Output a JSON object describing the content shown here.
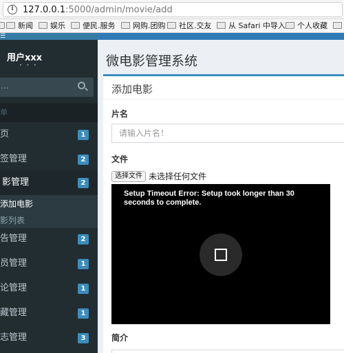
{
  "browser": {
    "url_host": "127.0.0.1",
    "url_rest": ":5000/admin/movie/add",
    "bookmarks": [
      "新闻",
      "娱乐",
      "便民.服务",
      "网购.团购",
      "社区.交友",
      "从 Safari 中导入",
      "个人收藏"
    ]
  },
  "sidebar": {
    "user_name": "用户xxx",
    "user_status": "• • •",
    "search_placeholder": "...",
    "menu_header": "单",
    "items": [
      {
        "label": "页",
        "badge": "1"
      },
      {
        "label": "签管理",
        "badge": "2"
      },
      {
        "label": "影管理",
        "badge": "2"
      },
      {
        "label": "告管理",
        "badge": "2"
      },
      {
        "label": "员管理",
        "badge": "1"
      },
      {
        "label": "论管理",
        "badge": "1"
      },
      {
        "label": "藏管理",
        "badge": "1"
      },
      {
        "label": "志管理",
        "badge": "3"
      }
    ],
    "submenu": {
      "current": "添加电影",
      "other": "影列表"
    }
  },
  "content": {
    "page_title": "微电影管理系统",
    "box_title": "添加电影",
    "field_title_label": "片名",
    "field_title_placeholder": "请输入片名！",
    "field_file_label": "文件",
    "file_button": "选择文件",
    "file_status": "未选择任何文件",
    "player_error": "Setup Timeout Error: Setup took longer than 30 seconds to complete.",
    "field_intro_label": "简介"
  },
  "colors": {
    "sidebar": "#222d32",
    "accent": "#3c8dbc",
    "header": "#2f7ab6"
  }
}
